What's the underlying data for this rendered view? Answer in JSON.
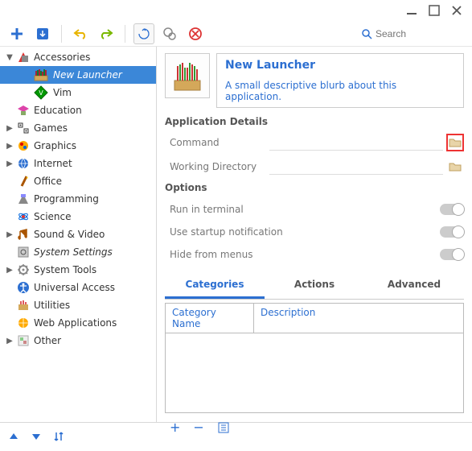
{
  "window": {
    "title": ""
  },
  "search": {
    "placeholder": "Search"
  },
  "tree": {
    "accessories": {
      "label": "Accessories",
      "expanded": true,
      "children": [
        {
          "id": "new-launcher",
          "label": "New Launcher",
          "selected": true
        },
        {
          "id": "vim",
          "label": "Vim"
        }
      ]
    },
    "items": [
      {
        "label": "Education",
        "expandable": false
      },
      {
        "label": "Games",
        "expandable": true
      },
      {
        "label": "Graphics",
        "expandable": true
      },
      {
        "label": "Internet",
        "expandable": true
      },
      {
        "label": "Office",
        "expandable": false
      },
      {
        "label": "Programming",
        "expandable": false
      },
      {
        "label": "Science",
        "expandable": false
      },
      {
        "label": "Sound & Video",
        "expandable": true
      },
      {
        "label": "System Settings",
        "expandable": false,
        "italic": true
      },
      {
        "label": "System Tools",
        "expandable": true
      },
      {
        "label": "Universal Access",
        "expandable": false
      },
      {
        "label": "Utilities",
        "expandable": false
      },
      {
        "label": "Web Applications",
        "expandable": false
      },
      {
        "label": "Other",
        "expandable": true
      }
    ]
  },
  "header": {
    "title": "New Launcher",
    "blurb": "A small descriptive blurb about this application."
  },
  "details": {
    "heading": "Application Details",
    "command_label": "Command",
    "command_value": "",
    "workdir_label": "Working Directory",
    "workdir_value": ""
  },
  "options": {
    "heading": "Options",
    "run_terminal": "Run in terminal",
    "startup_notify": "Use startup notification",
    "hide_menus": "Hide from menus"
  },
  "tabs": {
    "categories": "Categories",
    "actions": "Actions",
    "advanced": "Advanced"
  },
  "table": {
    "col_name": "Category Name",
    "col_desc": "Description"
  }
}
